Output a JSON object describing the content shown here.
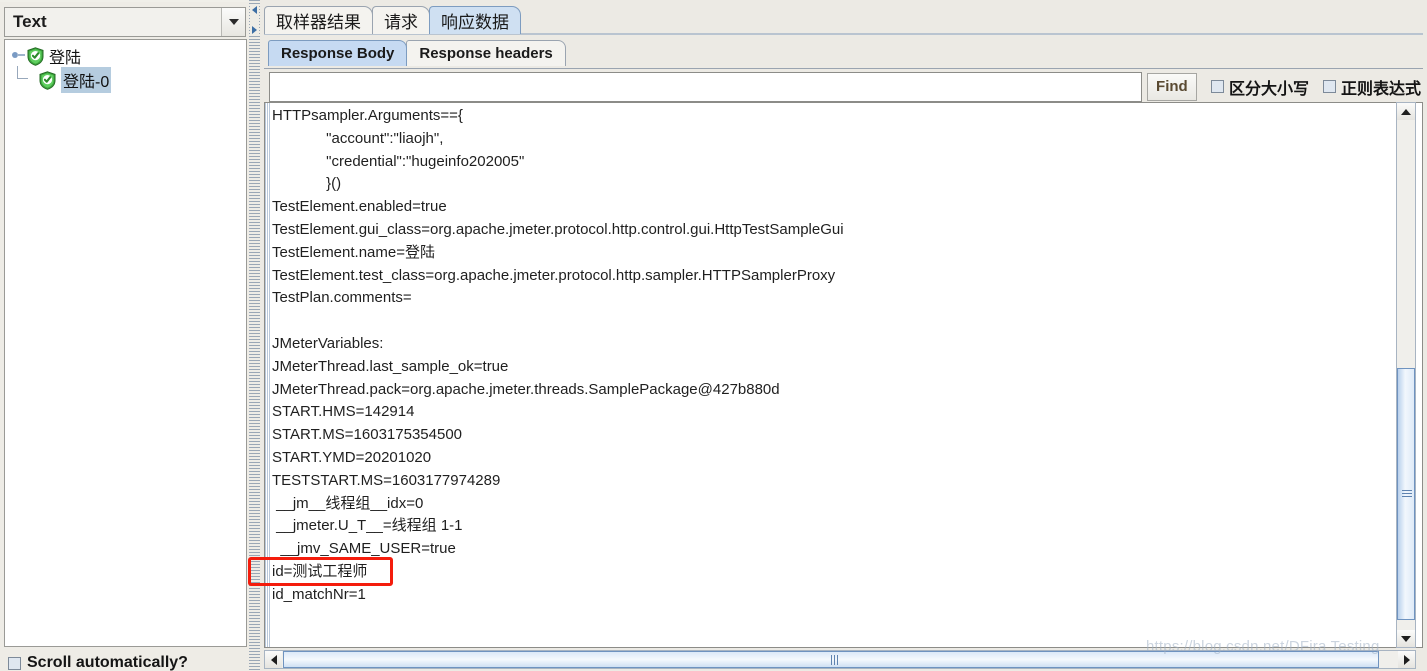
{
  "left_panel": {
    "combo": {
      "selected": "Text",
      "icon": "chevron-down-icon"
    },
    "tree": {
      "nodes": [
        {
          "label": "登陆",
          "icon": "green-shield-check-icon",
          "selected": false
        },
        {
          "label": "登陆-0",
          "icon": "green-shield-check-icon",
          "selected": true
        }
      ]
    },
    "scroll_auto": {
      "label": "Scroll automatically?",
      "checked": false
    }
  },
  "right_panel": {
    "outer_tabs": [
      {
        "label": "取样器结果",
        "active": false
      },
      {
        "label": "请求",
        "active": false
      },
      {
        "label": "响应数据",
        "active": true
      }
    ],
    "inner_tabs": [
      {
        "label": "Response Body",
        "active": true
      },
      {
        "label": "Response headers",
        "active": false
      }
    ],
    "search": {
      "value": "",
      "placeholder": "",
      "find_label": "Find",
      "case_sensitive": {
        "label": "区分大小写",
        "checked": false
      },
      "regex": {
        "label": "正则表达式",
        "checked": false
      }
    },
    "results_text": "HTTPsampler.Arguments=={\n             \"account\":\"liaojh\",\n             \"credential\":\"hugeinfo202005\"\n             }()\nTestElement.enabled=true\nTestElement.gui_class=org.apache.jmeter.protocol.http.control.gui.HttpTestSampleGui\nTestElement.name=登陆\nTestElement.test_class=org.apache.jmeter.protocol.http.sampler.HTTPSamplerProxy\nTestPlan.comments=\n\nJMeterVariables:\nJMeterThread.last_sample_ok=true\nJMeterThread.pack=org.apache.jmeter.threads.SamplePackage@427b880d\nSTART.HMS=142914\nSTART.MS=1603175354500\nSTART.YMD=20201020\nTESTSTART.MS=1603177974289\n __jm__线程组__idx=0\n __jmeter.U_T__=线程组 1-1\n  __jmv_SAME_USER=true\nid=测试工程师\nid_matchNr=1",
    "annotation": {
      "target_line": "id=测试工程师",
      "color": "#f41c0c"
    },
    "scrollbars": {
      "vertical": {
        "up_icon": "triangle-up-icon",
        "down_icon": "triangle-down-icon"
      },
      "horizontal": {
        "left_icon": "triangle-left-icon",
        "right_icon": "triangle-right-icon"
      }
    }
  },
  "watermark": "https://blog.csdn.net/DFira Testing"
}
